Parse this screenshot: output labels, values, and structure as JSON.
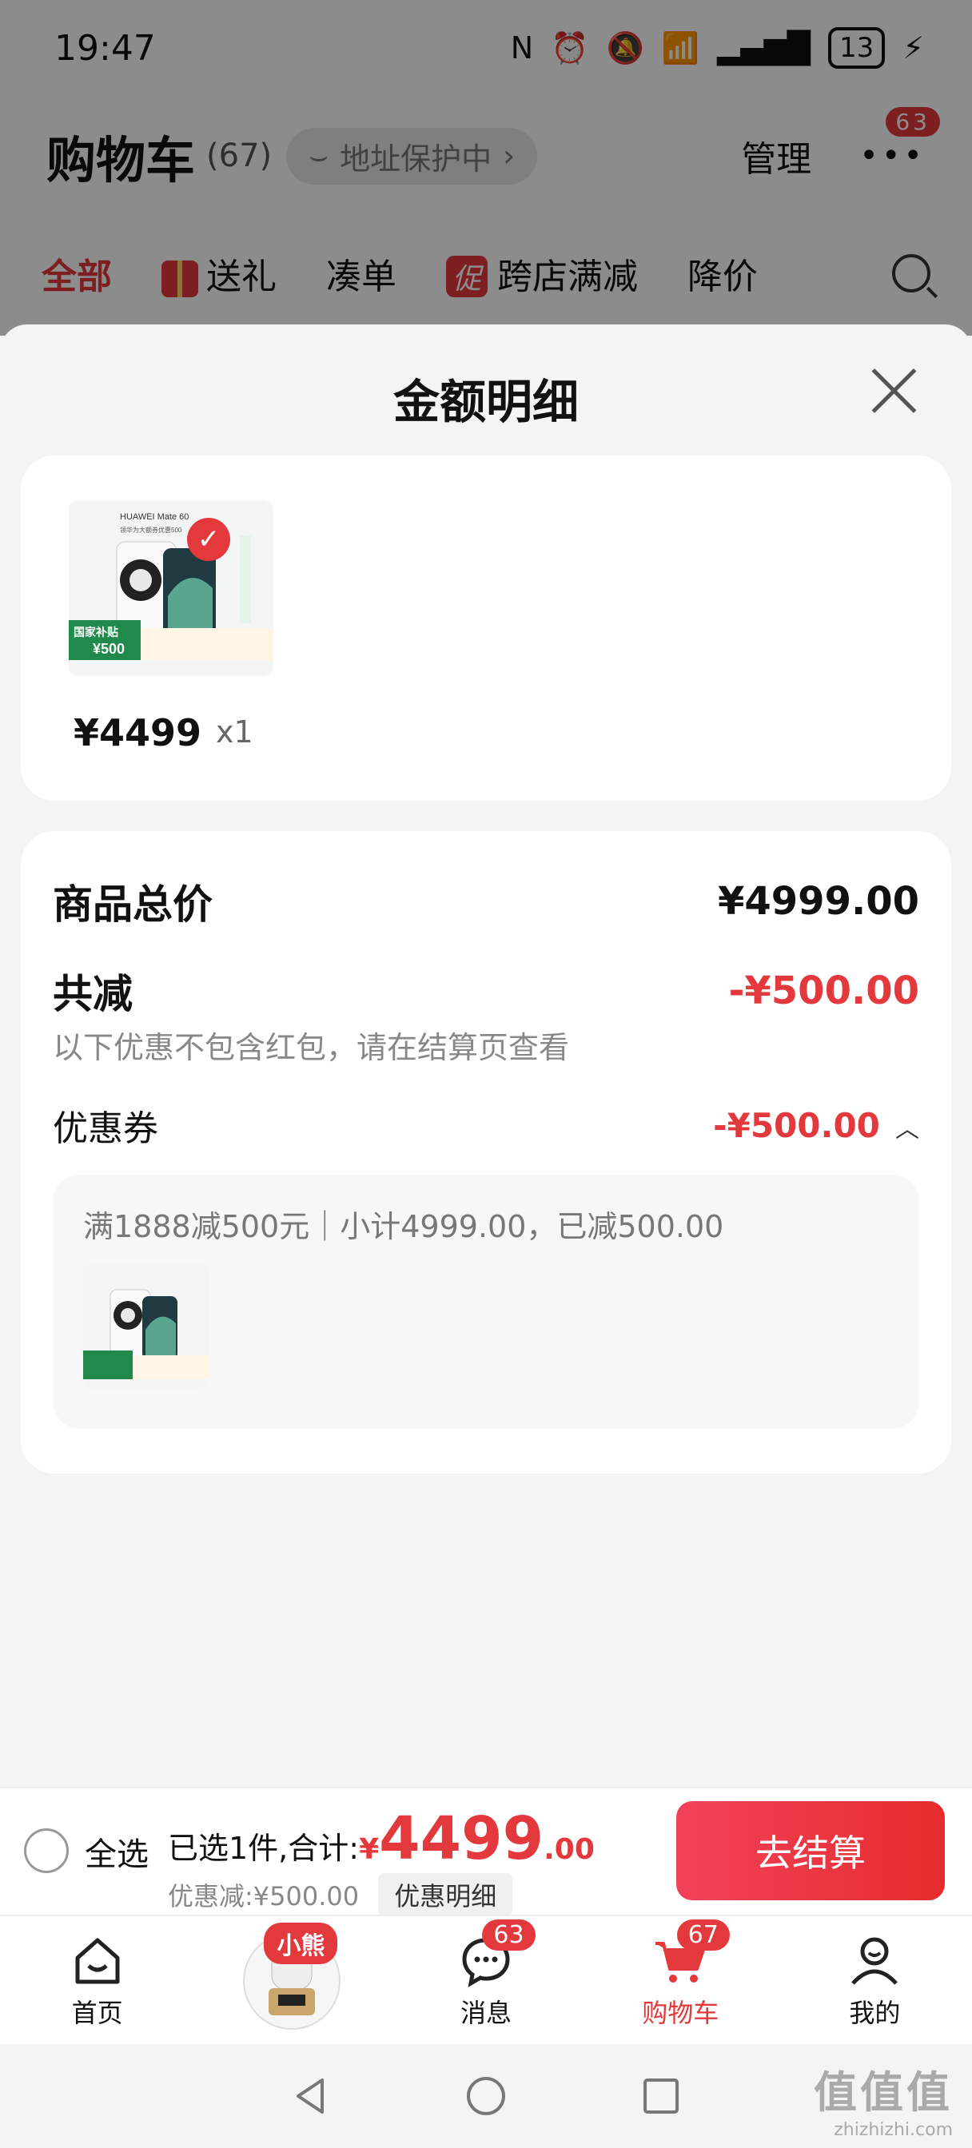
{
  "status": {
    "time": "19:47",
    "battery": "13"
  },
  "cart": {
    "title": "购物车",
    "count": "(67)",
    "address": "地址保护中",
    "manage": "管理",
    "menu_badge": "63",
    "tabs": [
      "全部",
      "送礼",
      "凑单",
      "跨店满减",
      "降价"
    ],
    "promo_tag": "促"
  },
  "sheet": {
    "title": "金额明细",
    "product": {
      "price": "¥4499",
      "qty": "x1",
      "img_brand": "HUAWEI Mate 60",
      "img_text": "领华为大额券优惠500",
      "subsidy_tag": "国家补贴",
      "subsidy_amount": "¥500"
    },
    "total_label": "商品总价",
    "total_value": "¥4999.00",
    "reduce_label": "共减",
    "reduce_value": "-¥500.00",
    "note": "以下优惠不包含红包，请在结算页查看",
    "coupon_label": "优惠券",
    "coupon_value": "-¥500.00",
    "coupon_desc": "满1888减500元｜小计4999.00，已减500.00"
  },
  "bottom": {
    "select_all": "全选",
    "selected_text": "已选1件,合计:",
    "currency": "¥",
    "total_int": "4499",
    "total_dec": ".00",
    "discount": "优惠减:¥500.00",
    "detail_button": "优惠明细",
    "checkout": "去结算"
  },
  "tabbar": {
    "items": [
      "首页",
      "",
      "消息",
      "购物车",
      "我的"
    ],
    "xiaoxiong_badge": "小熊",
    "message_badge": "63",
    "cart_badge": "67"
  },
  "watermark": {
    "big": "值值值",
    "small": "zhizhizhi.com"
  },
  "colors": {
    "accent": "#e4393c"
  }
}
